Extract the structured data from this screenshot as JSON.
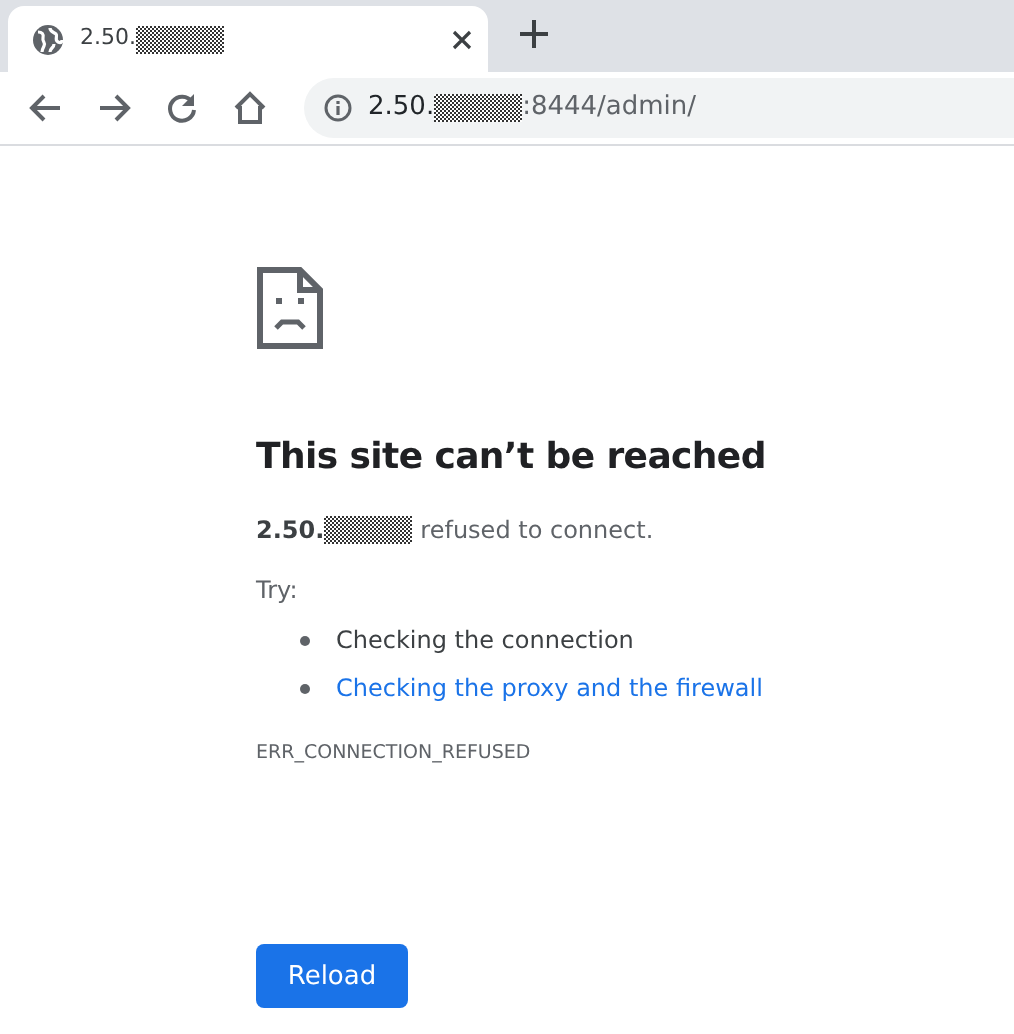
{
  "tab": {
    "title": "2.50.",
    "redacted": true,
    "selected": true
  },
  "toolbar": {
    "url_host": "2.50.",
    "redacted": true,
    "url_rest": ":8444/admin/"
  },
  "error": {
    "title": "This site can’t be reached",
    "host": "2.50.",
    "redacted": true,
    "message": "refused to connect.",
    "try_label": "Try:",
    "suggestions": [
      {
        "kind": "text",
        "text": "Checking the connection"
      },
      {
        "kind": "link",
        "text": "Checking the proxy and the firewall"
      }
    ],
    "code": "ERR_CONNECTION_REFUSED"
  },
  "buttons": [
    {
      "label": "Reload"
    }
  ]
}
